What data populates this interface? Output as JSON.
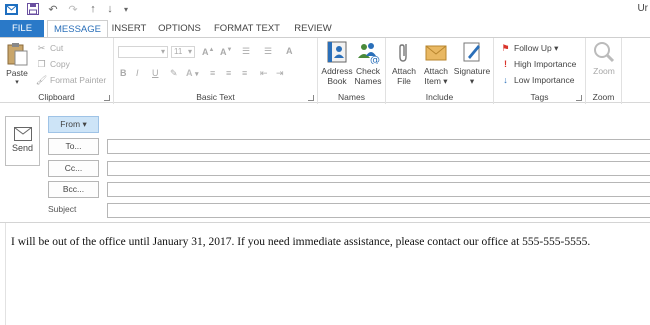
{
  "window": {
    "title_partial": "Ur"
  },
  "quick_access": {
    "icons": [
      "outlook-icon",
      "save-icon",
      "undo-icon",
      "redo-icon",
      "up-arrow-icon",
      "down-arrow-icon",
      "customize-qat-icon"
    ]
  },
  "tabs": [
    {
      "label": "FILE"
    },
    {
      "label": "MESSAGE"
    },
    {
      "label": "INSERT"
    },
    {
      "label": "OPTIONS"
    },
    {
      "label": "FORMAT TEXT"
    },
    {
      "label": "REVIEW"
    }
  ],
  "ribbon": {
    "clipboard": {
      "label": "Clipboard",
      "paste": "Paste",
      "cut": "Cut",
      "copy": "Copy",
      "format_painter": "Format Painter"
    },
    "basic_text": {
      "label": "Basic Text",
      "font_size": "11",
      "bold": "B",
      "italic": "I",
      "underline": "U",
      "font_color": "A"
    },
    "names": {
      "label": "Names",
      "address_book_1": "Address",
      "address_book_2": "Book",
      "check_names_1": "Check",
      "check_names_2": "Names"
    },
    "include": {
      "label": "Include",
      "attach_file_1": "Attach",
      "attach_file_2": "File",
      "attach_item_1": "Attach",
      "attach_item_2": "Item ▾",
      "signature_1": "Signature",
      "signature_2": "▾"
    },
    "tags": {
      "label": "Tags",
      "follow_up": "Follow Up ▾",
      "high_importance": "High Importance",
      "low_importance": "Low Importance"
    },
    "zoom": {
      "label": "Zoom",
      "zoom": "Zoom"
    }
  },
  "compose": {
    "send": "Send",
    "from": "From ▾",
    "to": "To...",
    "cc": "Cc...",
    "bcc": "Bcc...",
    "subject_label": "Subject",
    "to_value": "",
    "cc_value": "",
    "bcc_value": "",
    "subject_value": ""
  },
  "body": {
    "text": "I will be out of the office until January 31, 2017. If you need immediate assistance, please contact our office at 555-555-5555."
  },
  "colors": {
    "file_tab": "#2a79c8",
    "active_tab_text": "#2a6fb9",
    "from_button": "#cde4f7",
    "follow_up_flag": "#d9342b",
    "high_importance": "#d9342b",
    "low_importance": "#2a6fb9"
  }
}
